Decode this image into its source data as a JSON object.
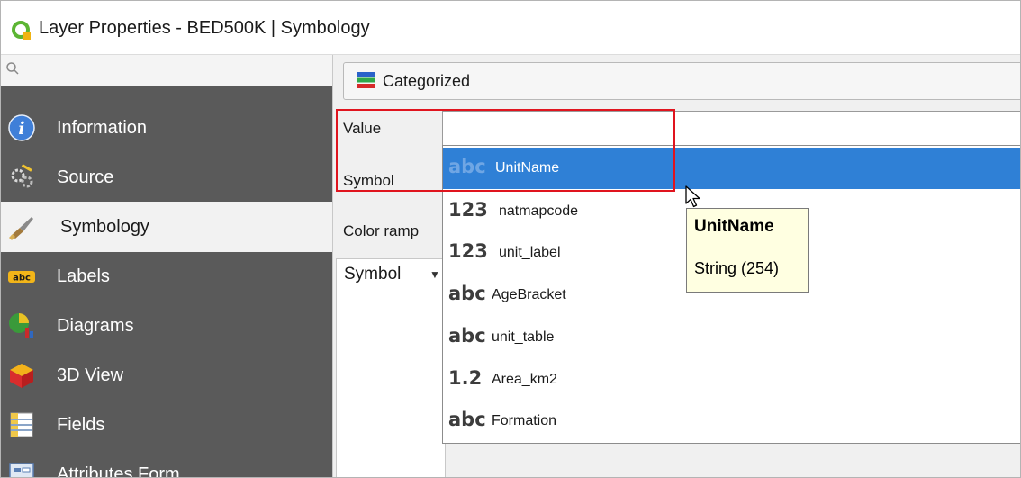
{
  "window": {
    "title": "Layer Properties - BED500K | Symbology"
  },
  "sidebar": {
    "search": {
      "placeholder": ""
    },
    "items": [
      {
        "label": "Information",
        "icon": "info-icon"
      },
      {
        "label": "Source",
        "icon": "source-icon"
      },
      {
        "label": "Symbology",
        "icon": "paintbrush-icon",
        "active": true
      },
      {
        "label": "Labels",
        "icon": "abc-label-icon"
      },
      {
        "label": "Diagrams",
        "icon": "diagrams-icon"
      },
      {
        "label": "3D View",
        "icon": "cube-icon"
      },
      {
        "label": "Fields",
        "icon": "fields-icon"
      },
      {
        "label": "Attributes Form",
        "icon": "form-icon"
      }
    ]
  },
  "symbology": {
    "renderer": "Categorized",
    "value_label": "Value",
    "symbol_label": "Symbol",
    "color_ramp_label": "Color ramp",
    "symbol_column_header": "Symbol",
    "value_field": {
      "selected": "UnitName",
      "options": [
        {
          "type": "abc",
          "name": "UnitName"
        },
        {
          "type": "123",
          "name": "natmapcode"
        },
        {
          "type": "123",
          "name": "unit_label"
        },
        {
          "type": "abc",
          "name": "AgeBracket"
        },
        {
          "type": "abc",
          "name": "unit_table"
        },
        {
          "type": "1.2",
          "name": "Area_km2"
        },
        {
          "type": "abc",
          "name": "Formation"
        }
      ]
    }
  },
  "tooltip": {
    "title": "UnitName",
    "subtitle": "String (254)"
  },
  "colors": {
    "sidebar_bg": "#5a5a5a",
    "selection_blue": "#2f80d6",
    "highlight_red": "#e0141e",
    "tooltip_bg": "#ffffe1"
  }
}
